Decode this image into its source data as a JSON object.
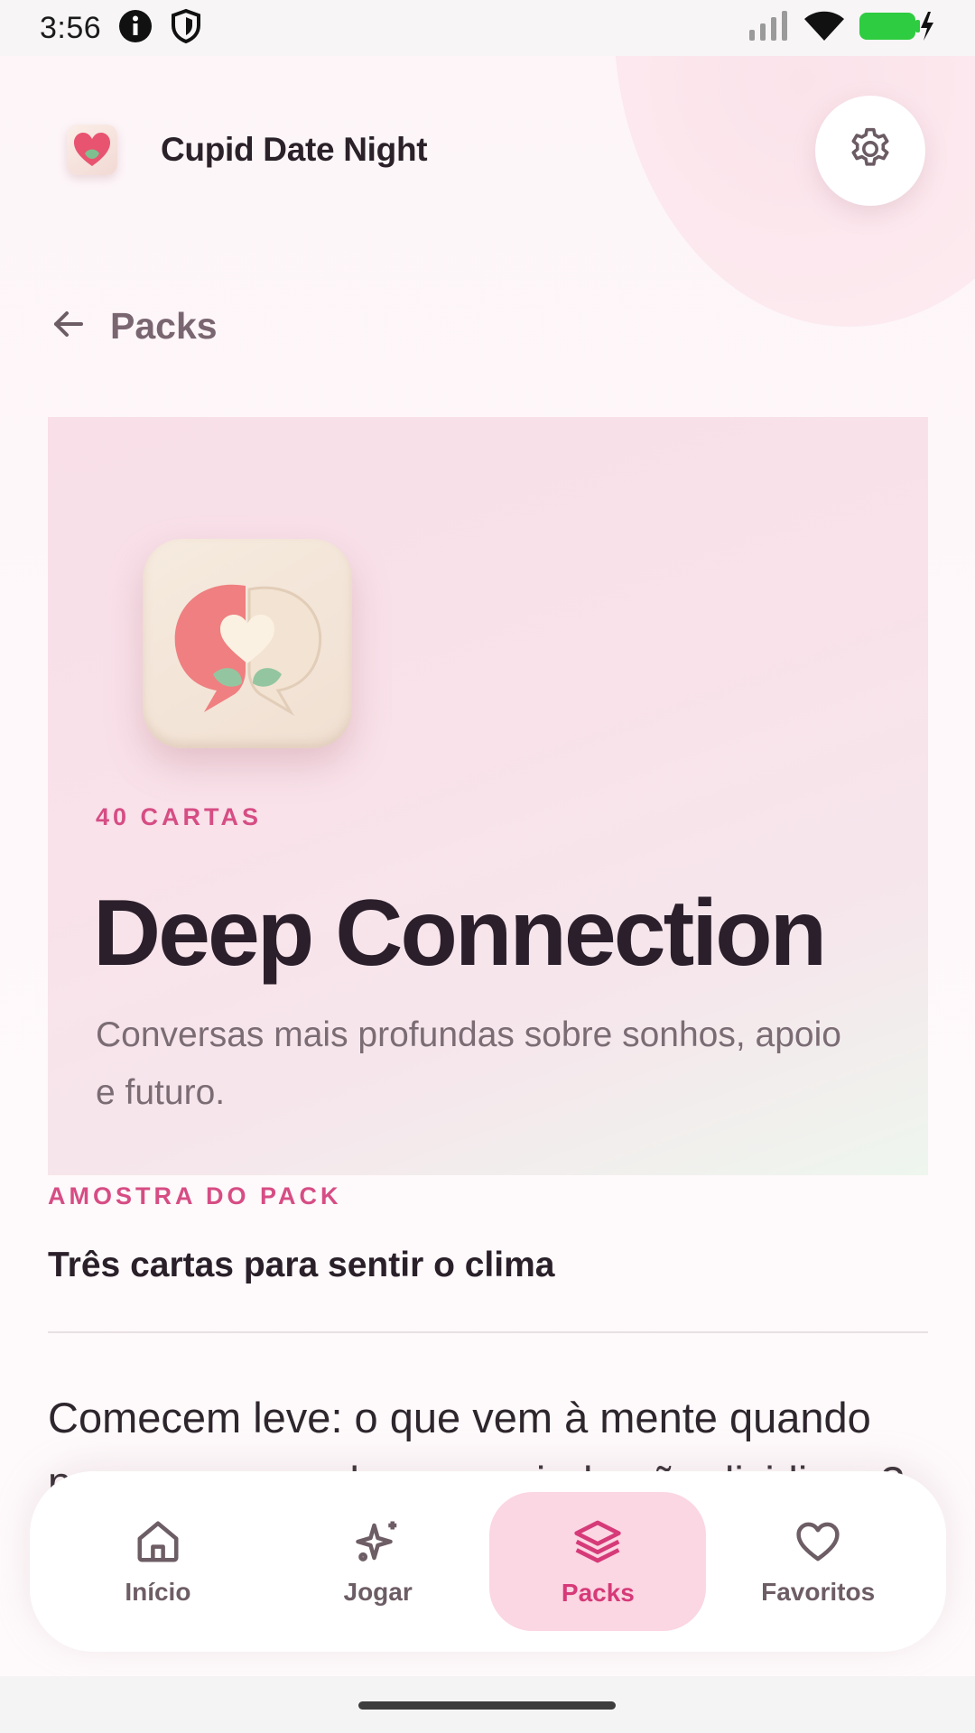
{
  "status_bar": {
    "time": "3:56",
    "icons": [
      "info-icon",
      "shield-icon",
      "signal-icon",
      "wifi-icon",
      "battery-charging-icon"
    ]
  },
  "header": {
    "app_title": "Cupid Date Night",
    "logo_icon": "heart-logo-icon",
    "settings_icon": "gear-icon"
  },
  "back": {
    "label": "Packs",
    "icon": "arrow-left-icon"
  },
  "hero": {
    "icon": "speech-hearts-icon",
    "count_label": "40 CARTAS",
    "title": "Deep Connection",
    "description": "Conversas mais profundas sobre sonhos, apoio e futuro."
  },
  "sample": {
    "kicker": "AMOSTRA DO PACK",
    "title": "Três cartas para sentir o clima",
    "card_text": "Comecem leve: o que vem à mente quando pensam em sonhos que ainda não dividiram?"
  },
  "bottom_nav": {
    "items": [
      {
        "label": "Início",
        "icon": "home-icon",
        "active": false
      },
      {
        "label": "Jogar",
        "icon": "sparkle-icon",
        "active": false
      },
      {
        "label": "Packs",
        "icon": "layers-icon",
        "active": true
      },
      {
        "label": "Favoritos",
        "icon": "heart-outline-icon",
        "active": false
      }
    ]
  },
  "colors": {
    "accent": "#d64d84",
    "active_nav_bg": "#fbd6e3",
    "title_text": "#2b1f2b"
  }
}
